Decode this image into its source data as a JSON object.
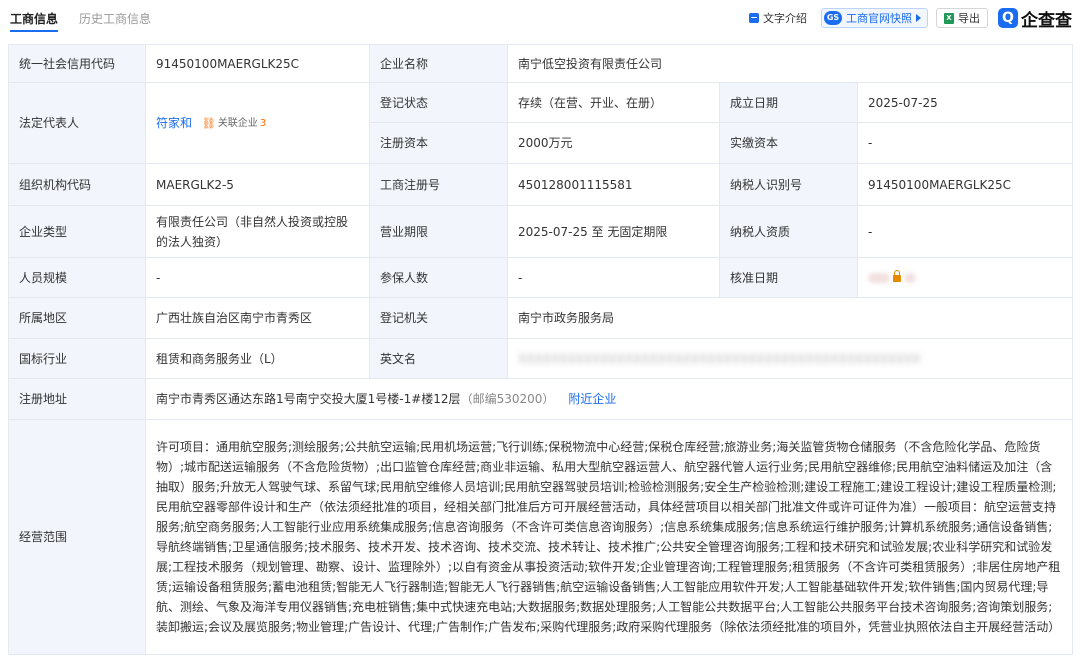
{
  "header": {
    "tabs": [
      {
        "label": "工商信息"
      },
      {
        "label": "历史工商信息"
      }
    ],
    "tools": {
      "text_intro": "文字介绍",
      "snapshot": "工商官网快照",
      "snapshot_badge": "GS",
      "export": "导出",
      "export_badge": "X",
      "brand_mark": "Q",
      "brand_name": "企查查"
    },
    "accent_color": "#1a6cf0"
  },
  "table": {
    "credit_code": {
      "label": "统一社会信用代码",
      "value": "91450100MAERGLK25C"
    },
    "company_name": {
      "label": "企业名称",
      "value": "南宁低空投资有限责任公司"
    },
    "legal_rep": {
      "label": "法定代表人",
      "value": "符家和",
      "assoc_label": "关联企业",
      "assoc_count": "3"
    },
    "reg_status": {
      "label": "登记状态",
      "value": "存续（在营、开业、在册）"
    },
    "established": {
      "label": "成立日期",
      "value": "2025-07-25"
    },
    "reg_capital": {
      "label": "注册资本",
      "value": "2000万元"
    },
    "paid_capital": {
      "label": "实缴资本",
      "value": "-"
    },
    "org_code": {
      "label": "组织机构代码",
      "value": "MAERGLK2-5"
    },
    "reg_number": {
      "label": "工商注册号",
      "value": "450128001115581"
    },
    "taxpayer_id": {
      "label": "纳税人识别号",
      "value": "91450100MAERGLK25C"
    },
    "company_type": {
      "label": "企业类型",
      "value": "有限责任公司（非自然人投资或控股的法人独资）"
    },
    "business_term": {
      "label": "营业期限",
      "value": "2025-07-25 至 无固定期限"
    },
    "taxpayer_qual": {
      "label": "纳税人资质",
      "value": "-"
    },
    "staff_size": {
      "label": "人员规模",
      "value": "-"
    },
    "insured": {
      "label": "参保人数",
      "value": "-"
    },
    "approval_date": {
      "label": "核准日期",
      "value": ""
    },
    "region": {
      "label": "所属地区",
      "value": "广西壮族自治区南宁市青秀区"
    },
    "reg_authority": {
      "label": "登记机关",
      "value": "南宁市政务服务局"
    },
    "industry": {
      "label": "国标行业",
      "value": "租赁和商务服务业（L）"
    },
    "english_name": {
      "label": "英文名",
      "value": ""
    },
    "address": {
      "label": "注册地址",
      "value": "南宁市青秀区通达东路1号南宁交投大厦1号楼-1#楼12层",
      "postal": "（邮编530200）",
      "nearby": "附近企业"
    },
    "scope": {
      "label": "经营范围",
      "value": "许可项目：通用航空服务;测绘服务;公共航空运输;民用机场运营;飞行训练;保税物流中心经营;保税仓库经营;旅游业务;海关监管货物仓储服务（不含危险化学品、危险货物）;城市配送运输服务（不含危险货物）;出口监管仓库经营;商业非运输、私用大型航空器运营人、航空器代管人运行业务;民用航空器维修;民用航空油料储运及加注（含抽取）服务;升放无人驾驶气球、系留气球;民用航空维修人员培训;民用航空器驾驶员培训;检验检测服务;安全生产检验检测;建设工程施工;建设工程设计;建设工程质量检测;民用航空器零部件设计和生产（依法须经批准的项目，经相关部门批准后方可开展经营活动，具体经营项目以相关部门批准文件或许可证件为准）一般项目：航空运营支持服务;航空商务服务;人工智能行业应用系统集成服务;信息咨询服务（不含许可类信息咨询服务）;信息系统集成服务;信息系统运行维护服务;计算机系统服务;通信设备销售;导航终端销售;卫星通信服务;技术服务、技术开发、技术咨询、技术交流、技术转让、技术推广;公共安全管理咨询服务;工程和技术研究和试验发展;农业科学研究和试验发展;工程技术服务（规划管理、勘察、设计、监理除外）;以自有资金从事投资活动;软件开发;企业管理咨询;工程管理服务;租赁服务（不含许可类租赁服务）;非居住房地产租赁;运输设备租赁服务;蓄电池租赁;智能无人飞行器制造;智能无人飞行器销售;航空运输设备销售;人工智能应用软件开发;人工智能基础软件开发;软件销售;国内贸易代理;导航、测绘、气象及海洋专用仪器销售;充电桩销售;集中式快速充电站;大数据服务;数据处理服务;人工智能公共数据平台;人工智能公共服务平台技术咨询服务;咨询策划服务;装卸搬运;会议及展览服务;物业管理;广告设计、代理;广告制作;广告发布;采购代理服务;政府采购代理服务（除依法须经批准的项目外，凭营业执照依法自主开展经营活动）"
    }
  }
}
